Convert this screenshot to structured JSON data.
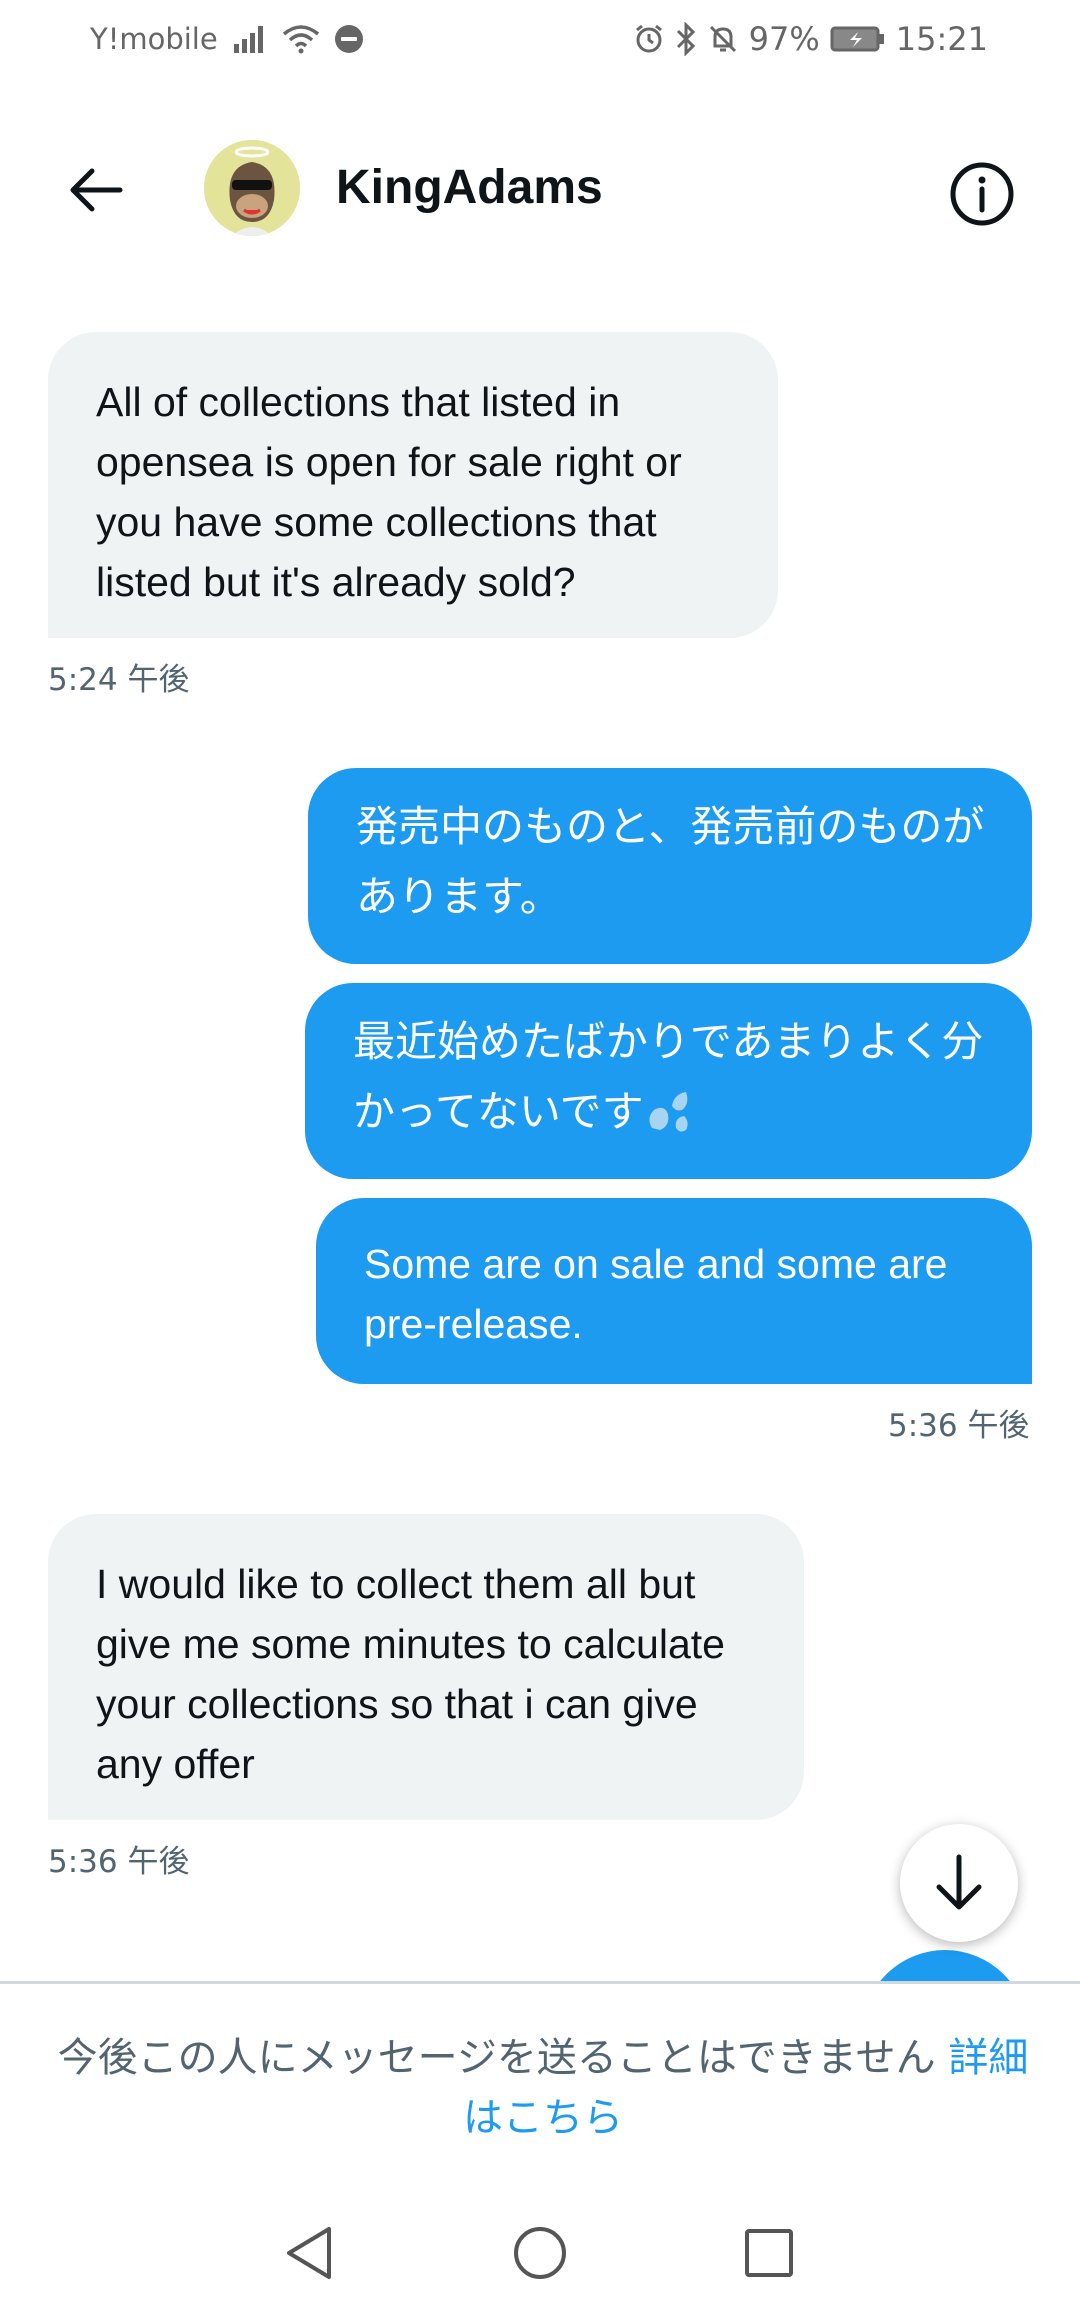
{
  "status_bar": {
    "carrier": "Y!mobile",
    "battery": "97%",
    "time": "15:21"
  },
  "header": {
    "contact_name": "KingAdams",
    "back_icon": "arrow-left-icon",
    "info_icon": "info-circle-icon"
  },
  "messages": [
    {
      "direction": "in",
      "text": "All of collections that listed in opensea is open for sale right or you have some collections that listed but it's already sold?"
    },
    {
      "direction": "out",
      "text": "発売中のものと、発売前のものがあります。"
    },
    {
      "direction": "out",
      "text": "最近始めたばかりであまりよく分かってないです"
    },
    {
      "direction": "out",
      "text": "Some are on sale and some are pre-release."
    },
    {
      "direction": "in",
      "text": "I would like to collect them all but give me some minutes to calculate your collections so that i can give any offer"
    }
  ],
  "timestamps": [
    "5:24 午後",
    "5:36 午後",
    "5:36 午後"
  ],
  "footer_notice": {
    "text": "今後この人にメッセージを送ることはできません",
    "link": "詳細はこちら"
  },
  "colors": {
    "accent": "#1d9bf0",
    "incoming_bubble": "#eff3f4",
    "secondary_text": "#536471"
  }
}
